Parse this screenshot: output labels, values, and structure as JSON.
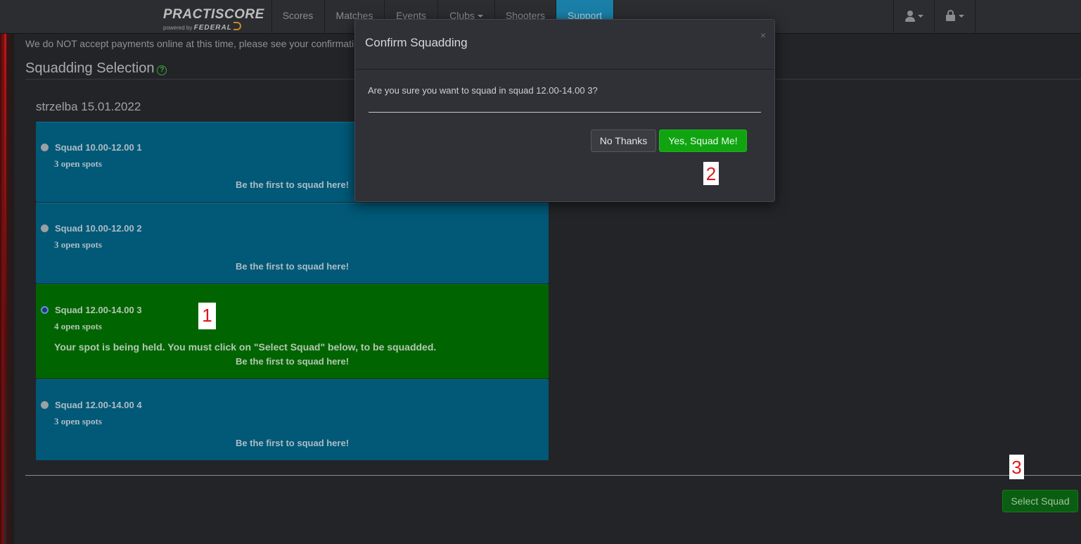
{
  "navbar": {
    "brand": {
      "name": "PRACTISCORE",
      "powered_by": "powered by",
      "partner": "FEDERAL"
    },
    "items": [
      {
        "label": "Scores"
      },
      {
        "label": "Matches"
      },
      {
        "label": "Events"
      },
      {
        "label": "Clubs"
      },
      {
        "label": "Shooters"
      },
      {
        "label": "Support"
      }
    ],
    "active_item": "Support",
    "right_icons": [
      "user-icon",
      "lock-icon"
    ]
  },
  "page": {
    "notice": "We do NOT accept payments online at this time, please see your confirmati",
    "section_title": "Squadding Selection",
    "event_name": "strzelba 15.01.2022",
    "squads": [
      {
        "name": "Squad 10.00-12.00 1",
        "spots": "3 open spots",
        "first": "Be the first to squad here!",
        "selected": false
      },
      {
        "name": "Squad 10.00-12.00 2",
        "spots": "3 open spots",
        "first": "Be the first to squad here!",
        "selected": false
      },
      {
        "name": "Squad 12.00-14.00 3",
        "spots": "4 open spots",
        "held": "Your spot is being held. You must click on \"Select Squad\" below, to be squadded.",
        "first": "Be the first to squad here!",
        "selected": true
      },
      {
        "name": "Squad 12.00-14.00 4",
        "spots": "3 open spots",
        "first": "Be the first to squad here!",
        "selected": false
      }
    ],
    "select_button": "Select Squad"
  },
  "modal": {
    "title": "Confirm Squadding",
    "close": "×",
    "message": "Are you sure you want to squad in squad 12.00-14.00 3?",
    "no_button": "No Thanks",
    "yes_button": "Yes, Squad Me!"
  },
  "markers": [
    "1",
    "2",
    "3"
  ],
  "colors": {
    "squad_blue": "#015877",
    "squad_selected": "#006400",
    "nav_active": "#1a7fa8",
    "yes_button": "#11a411",
    "select_button": "#0b5d12",
    "marker_text": "#e01818"
  }
}
